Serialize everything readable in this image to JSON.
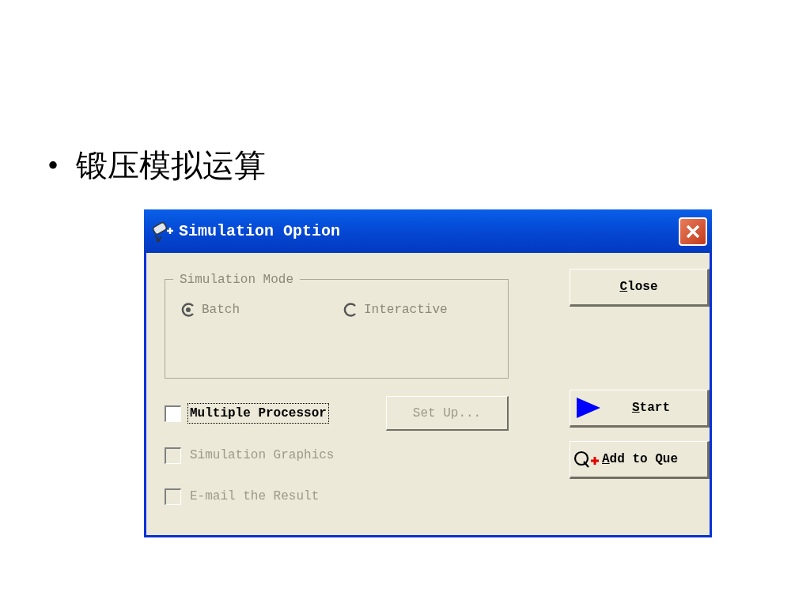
{
  "slide": {
    "bullet": "•",
    "heading": "锻压模拟运算"
  },
  "window": {
    "title": "Simulation Option"
  },
  "mode_group": {
    "legend": "Simulation Mode",
    "disabled": true,
    "options": [
      {
        "label": "Batch",
        "selected": true
      },
      {
        "label": "Interactive",
        "selected": false
      }
    ]
  },
  "checkboxes": [
    {
      "label": "Multiple Processor",
      "checked": false,
      "disabled": false,
      "focused": true
    },
    {
      "label": "Simulation Graphics",
      "checked": false,
      "disabled": true,
      "focused": false
    },
    {
      "label": "E-mail the Result",
      "checked": false,
      "disabled": true,
      "focused": false
    }
  ],
  "setup_button": {
    "label": "Set Up...",
    "disabled": true
  },
  "buttons": [
    {
      "kind": "close",
      "accel": "C",
      "rest": "lose"
    },
    {
      "kind": "start",
      "accel": "S",
      "rest": "tart"
    },
    {
      "kind": "queue",
      "accel": "A",
      "rest": "dd to Que"
    }
  ]
}
